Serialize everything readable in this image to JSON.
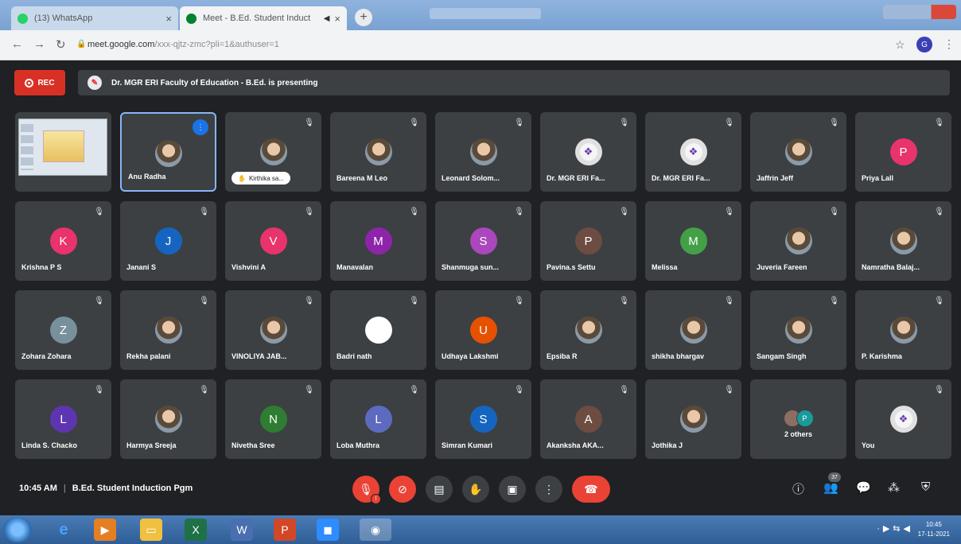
{
  "browser": {
    "tabs": [
      {
        "title": "(13) WhatsApp",
        "icon": "whatsapp-icon",
        "color": "#25d366"
      },
      {
        "title": "Meet - B.Ed. Student Induct",
        "icon": "meet-icon",
        "color": "#00832d"
      }
    ],
    "url_host": "meet.google.com",
    "url_rest": "/xxx-qjtz-zmc?pli=1&authuser=1",
    "profile_initial": "G"
  },
  "meet": {
    "rec_label": "REC",
    "presenting_text": "Dr. MGR ERI Faculty of Education - B.Ed. is presenting",
    "tiles": [
      {
        "kind": "screen"
      },
      {
        "name": "Anu Radha",
        "kind": "photo",
        "speaking": true
      },
      {
        "name": "Kirthika sa...",
        "kind": "photo",
        "pill": true
      },
      {
        "name": "Bareena M Leo",
        "kind": "photo"
      },
      {
        "name": "Leonard Solom...",
        "kind": "photo"
      },
      {
        "name": "Dr. MGR ERI Fa...",
        "kind": "logo"
      },
      {
        "name": "Dr. MGR ERI Fa...",
        "kind": "logo"
      },
      {
        "name": "Jaffrin Jeff",
        "kind": "photo"
      },
      {
        "name": "Priya Lall",
        "initial": "P",
        "color": "#e8336d"
      },
      {
        "name": "Krishna P S",
        "initial": "K",
        "color": "#e8336d"
      },
      {
        "name": "Janani S",
        "initial": "J",
        "color": "#1565c0"
      },
      {
        "name": "Vishvini A",
        "initial": "V",
        "color": "#e8336d"
      },
      {
        "name": "Manavalan",
        "initial": "M",
        "color": "#8e24aa"
      },
      {
        "name": "Shanmuga sun...",
        "initial": "S",
        "color": "#ab47bc"
      },
      {
        "name": "Pavina.s Settu",
        "initial": "P",
        "color": "#6d4c41"
      },
      {
        "name": "Melissa",
        "initial": "M",
        "color": "#43a047"
      },
      {
        "name": "Juveria Fareen",
        "kind": "photo"
      },
      {
        "name": "Namratha Balaj...",
        "kind": "photo"
      },
      {
        "name": "Zohara Zohara",
        "initial": "Z",
        "color": "#78909c"
      },
      {
        "name": "Rekha palani",
        "kind": "photo"
      },
      {
        "name": "VINOLIYA JAB...",
        "kind": "photo"
      },
      {
        "name": "Badri nath",
        "kind": "blank"
      },
      {
        "name": "Udhaya Lakshmi",
        "initial": "U",
        "color": "#e65100"
      },
      {
        "name": "Epsiba R",
        "kind": "photo"
      },
      {
        "name": "shikha bhargav",
        "kind": "photo"
      },
      {
        "name": "Sangam Singh",
        "kind": "photo"
      },
      {
        "name": "P. Karishma",
        "kind": "photo"
      },
      {
        "name": "Linda S. Chacko",
        "initial": "L",
        "color": "#5e35b1"
      },
      {
        "name": "Harmya Sreeja",
        "kind": "photo"
      },
      {
        "name": "Nivetha Sree",
        "initial": "N",
        "color": "#2e7d32"
      },
      {
        "name": "Loba Muthra",
        "initial": "L",
        "color": "#5c6bc0"
      },
      {
        "name": "Simran Kumari",
        "initial": "S",
        "color": "#1565c0"
      },
      {
        "name": "Akanksha AKA...",
        "initial": "A",
        "color": "#6d4c41"
      },
      {
        "name": "Jothika J",
        "kind": "photo"
      },
      {
        "kind": "others",
        "label": "2 others",
        "initial": "P"
      },
      {
        "name": "You",
        "kind": "logo"
      }
    ],
    "time": "10:45 AM",
    "meeting_title": "B.Ed. Student Induction Pgm",
    "participant_count": "37"
  },
  "taskbar": {
    "clock_time": "10:45",
    "clock_date": "17-11-2021"
  }
}
